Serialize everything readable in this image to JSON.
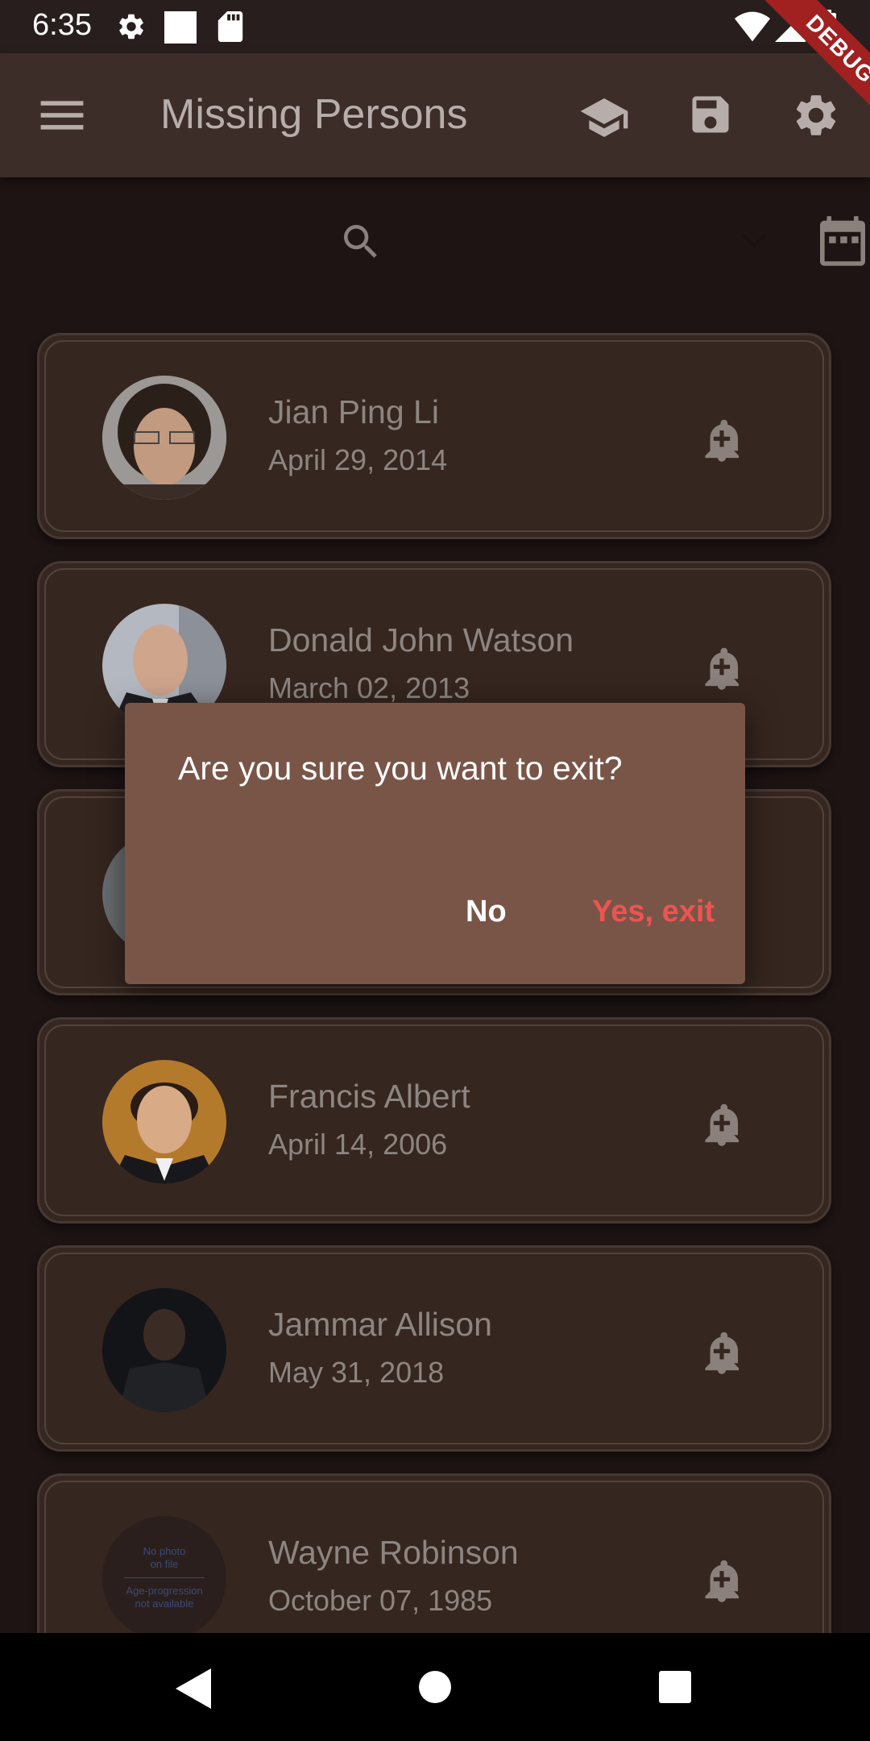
{
  "status_bar": {
    "time": "6:35"
  },
  "app_bar": {
    "title": "Missing Persons"
  },
  "debug_banner": "DEBUG",
  "persons": [
    {
      "name": "Jian Ping Li",
      "date": "April 29, 2014"
    },
    {
      "name": "Donald John Watson",
      "date": "March 02, 2013"
    },
    {
      "name": "",
      "date": ""
    },
    {
      "name": "Francis Albert",
      "date": "April 14, 2006"
    },
    {
      "name": "Jammar Allison",
      "date": "May 31, 2018"
    },
    {
      "name": "Wayne Robinson",
      "date": "October 07, 1985"
    }
  ],
  "placeholder_photo": {
    "line1": "No photo",
    "line2": "on file",
    "line3": "Age-progression",
    "line4": "not available"
  },
  "dialog": {
    "title": "Are you sure you want to exit?",
    "no_label": "No",
    "yes_label": "Yes, exit"
  },
  "colors": {
    "background": "#1e1414",
    "app_bar": "#3d2d28",
    "card": "#35261f",
    "dialog": "#795548",
    "accent_red": "#ef5350"
  },
  "icons": [
    "settings-icon",
    "notification-icon",
    "sd-card-icon",
    "wifi-icon",
    "signal-icon",
    "battery-icon",
    "menu-icon",
    "school-icon",
    "save-icon",
    "search-icon",
    "chevron-down-icon",
    "calendar-icon",
    "add-alert-icon",
    "back-icon",
    "home-icon",
    "recents-icon"
  ]
}
